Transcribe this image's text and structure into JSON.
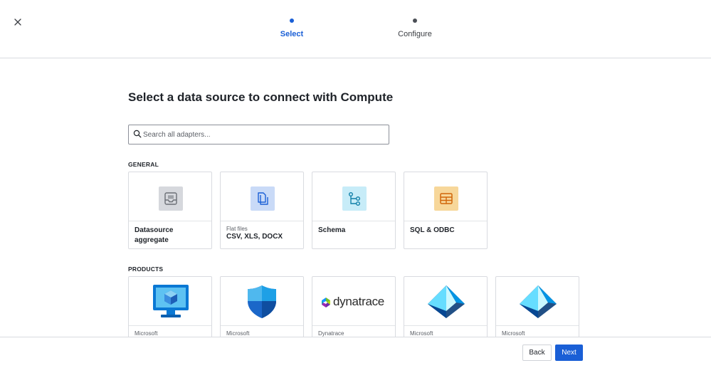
{
  "wizard": {
    "steps": [
      {
        "label": "Select",
        "state": "active"
      },
      {
        "label": "Configure",
        "state": "todo"
      }
    ]
  },
  "main": {
    "title": "Select a data source to connect with Compute",
    "search": {
      "placeholder": "Search all adapters...",
      "value": ""
    }
  },
  "sections": {
    "general": {
      "heading": "GENERAL",
      "cards": [
        {
          "subtitle": "",
          "name": "Datasource aggregate",
          "icon": "inbox-icon"
        },
        {
          "subtitle": "Flat files",
          "name": "CSV, XLS, DOCX",
          "icon": "document-icon"
        },
        {
          "subtitle": "",
          "name": "Schema",
          "icon": "schema-tree-icon"
        },
        {
          "subtitle": "",
          "name": "SQL & ODBC",
          "icon": "table-icon"
        }
      ]
    },
    "products": {
      "heading": "PRODUCTS",
      "cards": [
        {
          "subtitle": "Microsoft",
          "icon": "azure-virtual-machine-icon"
        },
        {
          "subtitle": "Microsoft",
          "icon": "azure-security-shield-icon"
        },
        {
          "subtitle": "Dynatrace",
          "logo_text": "dynatrace",
          "icon": "dynatrace-logo"
        },
        {
          "subtitle": "Microsoft",
          "icon": "azure-ad-pyramid-icon"
        },
        {
          "subtitle": "Microsoft",
          "icon": "azure-ad-pyramid-icon"
        }
      ]
    }
  },
  "footer": {
    "back_label": "Back",
    "next_label": "Next"
  },
  "colors": {
    "accent": "#1a5fd6",
    "border": "#d9dbe0",
    "text": "#1f2329"
  }
}
